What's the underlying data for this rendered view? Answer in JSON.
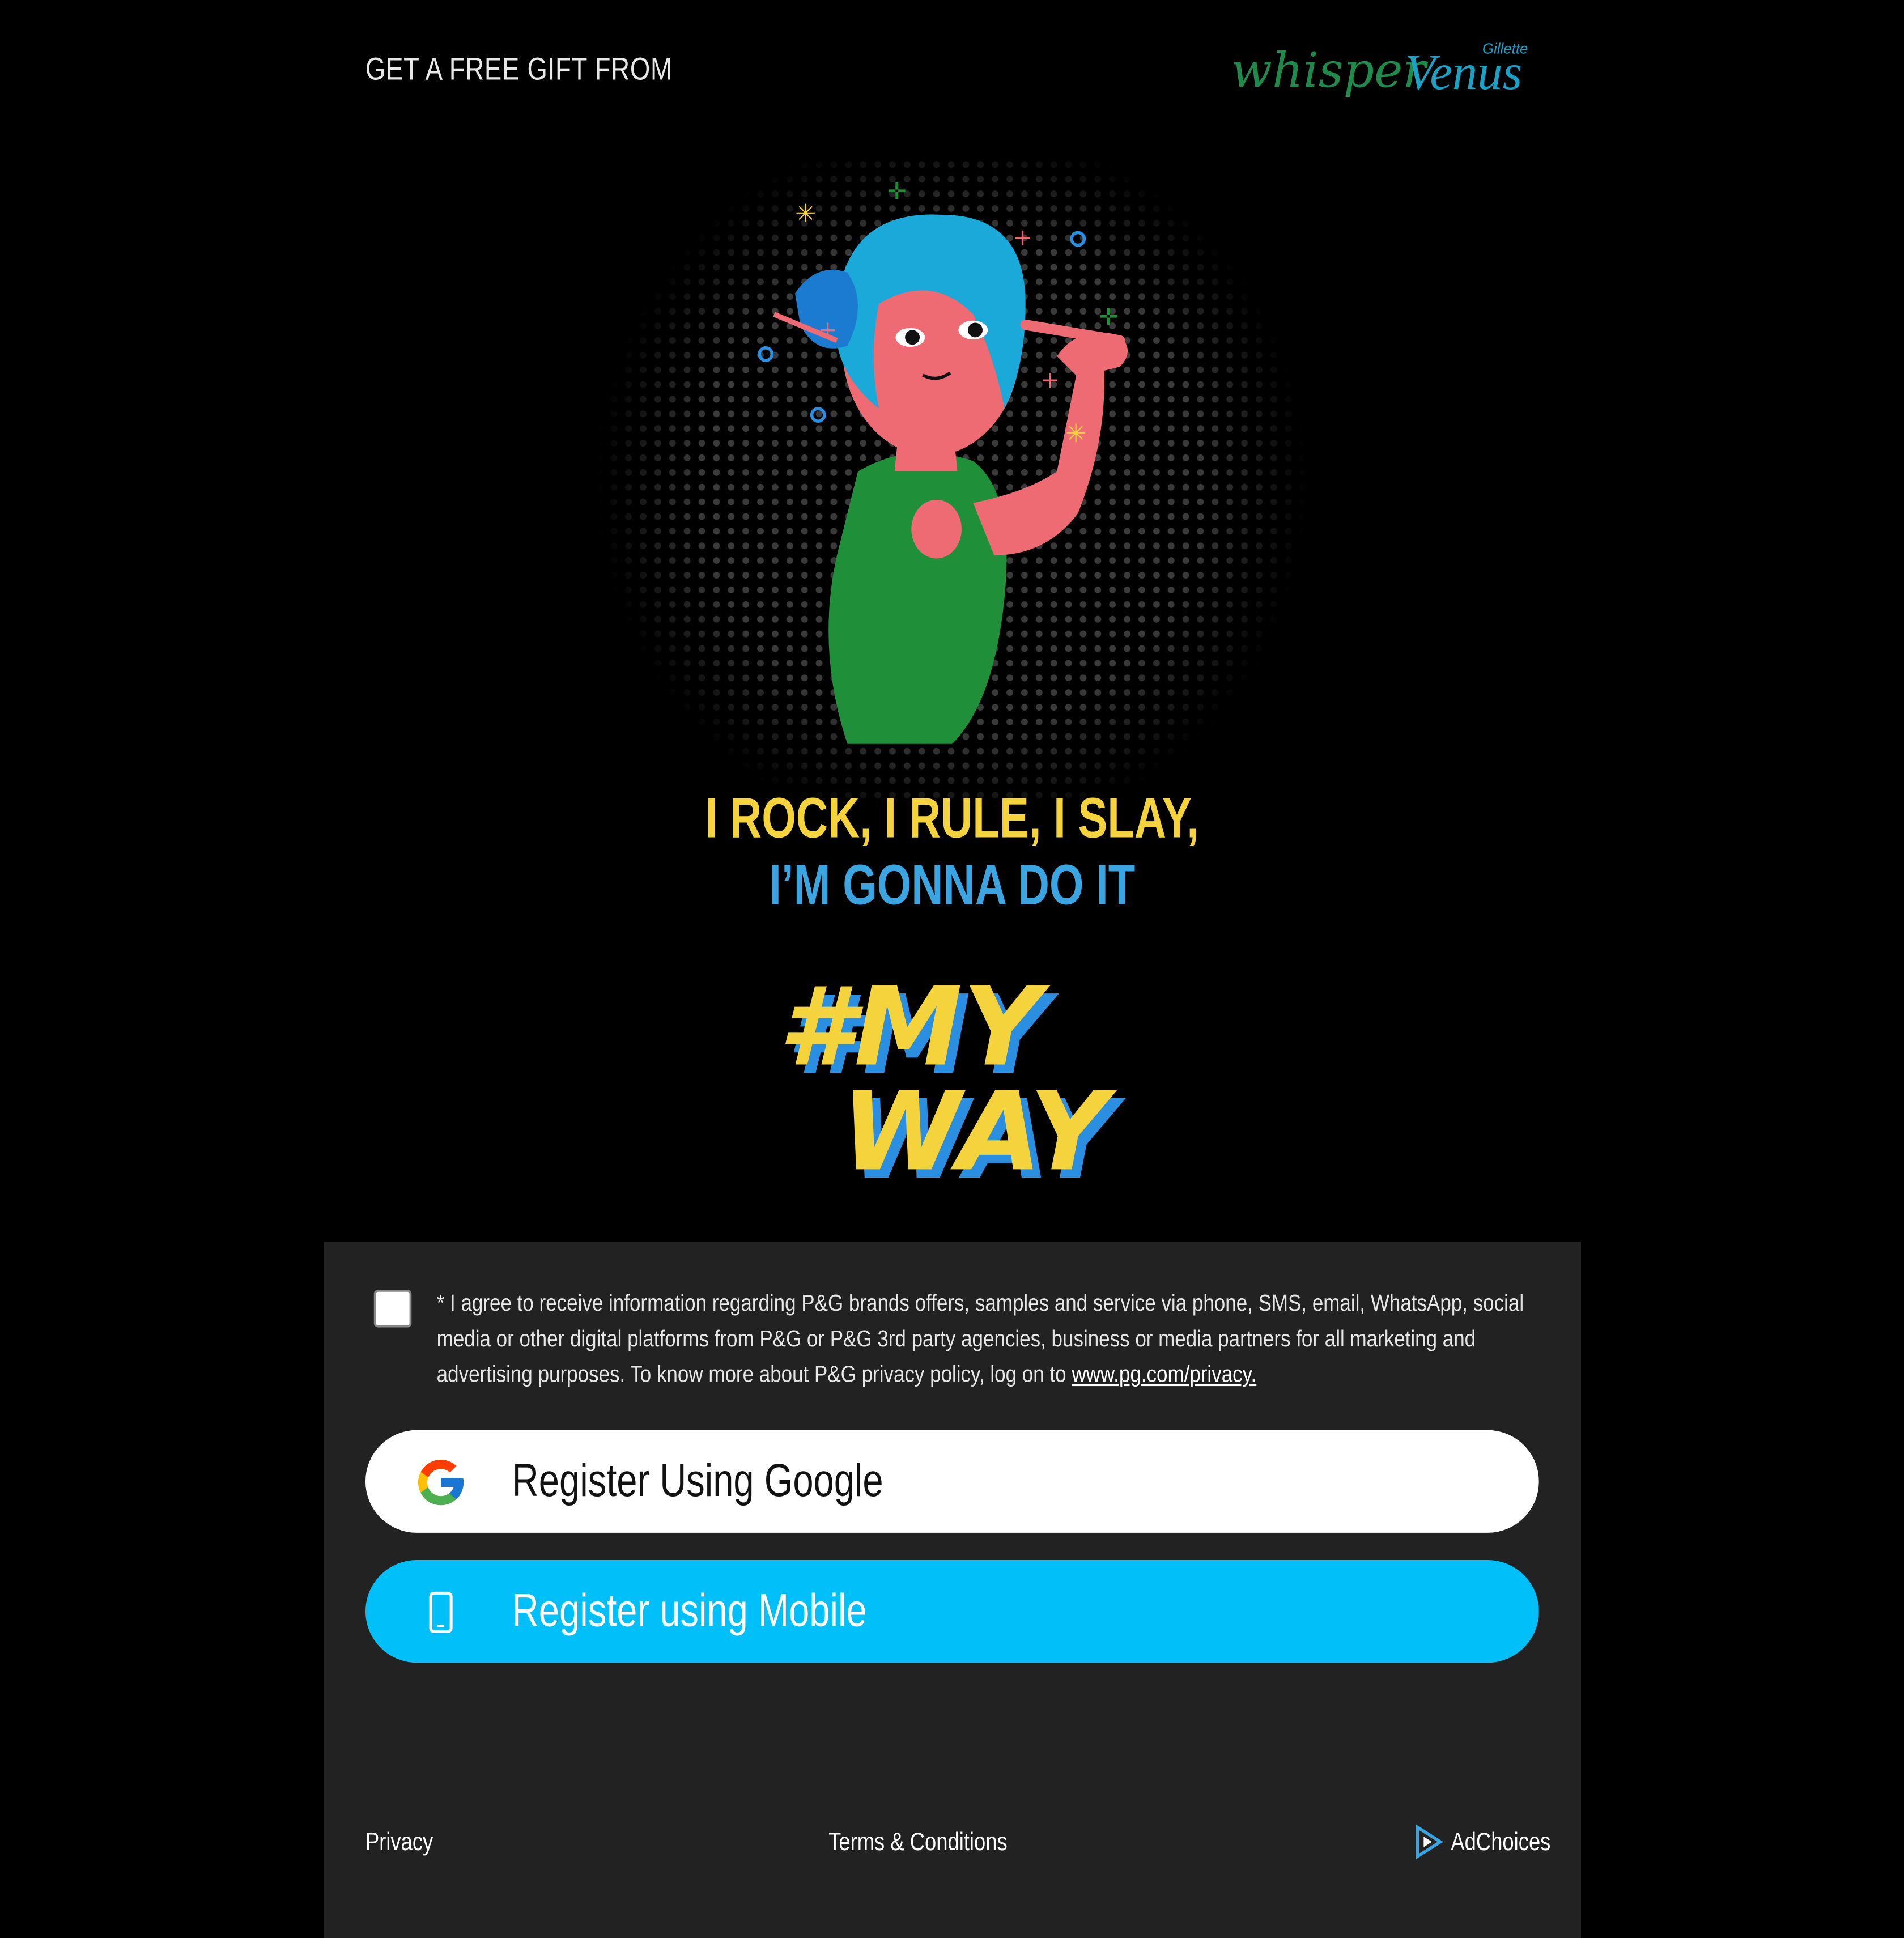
{
  "header": {
    "label": "GET A FREE GIFT FROM",
    "brands": {
      "whisper": "whisper",
      "venus": "Venus",
      "gillette": "Gillette"
    }
  },
  "hero": {
    "slogan_line1": "I ROCK, I RULE, I SLAY,",
    "slogan_line2": "I’M GONNA DO IT",
    "hashtag_line1": "#MY",
    "hashtag_line2": "WAY"
  },
  "consent": {
    "checked": false,
    "text": "* I agree to receive information regarding P&G brands offers, samples and service via phone, SMS, email, WhatsApp, social media or other digital platforms from P&G or P&G 3rd party agencies, business or media partners for all marketing and advertising purposes. To know more about P&G privacy policy, log on to ",
    "link": "www.pg.com/privacy."
  },
  "buttons": {
    "google": "Register Using Google",
    "mobile": "Register using Mobile"
  },
  "footer": {
    "privacy": "Privacy",
    "terms": "Terms & Conditions",
    "adchoices": "AdChoices"
  },
  "colors": {
    "background": "#000000",
    "panel": "#222222",
    "mobile_button": "#00bff9",
    "slogan_yellow": "#f5d33c",
    "slogan_blue": "#3aa5e0",
    "whisper_green": "#1f8a4c",
    "venus_teal": "#1aa1c4"
  },
  "icons": {
    "google": "google-g-icon",
    "mobile": "mobile-phone-icon",
    "adchoices": "adchoices-icon"
  }
}
